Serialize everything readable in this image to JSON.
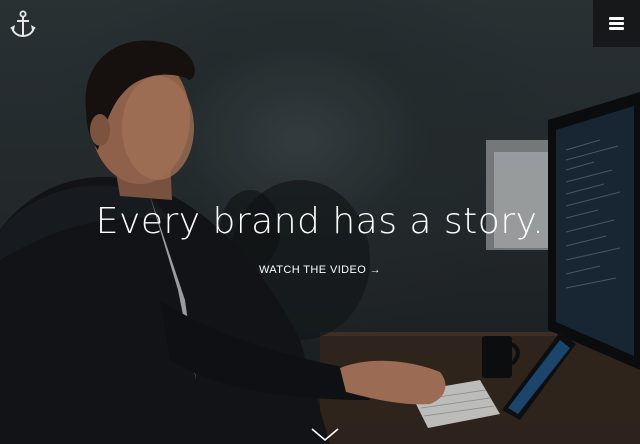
{
  "hero": {
    "headline": "Every brand has a story.",
    "cta_label": "WATCH THE VIDEO →"
  },
  "icons": {
    "logo": "anchor-icon",
    "menu": "hamburger-menu-icon",
    "scroll": "chevron-down-icon"
  },
  "colors": {
    "text": "#ffffff",
    "menu_button_bg": "#161819",
    "wall": "#2f383b"
  }
}
